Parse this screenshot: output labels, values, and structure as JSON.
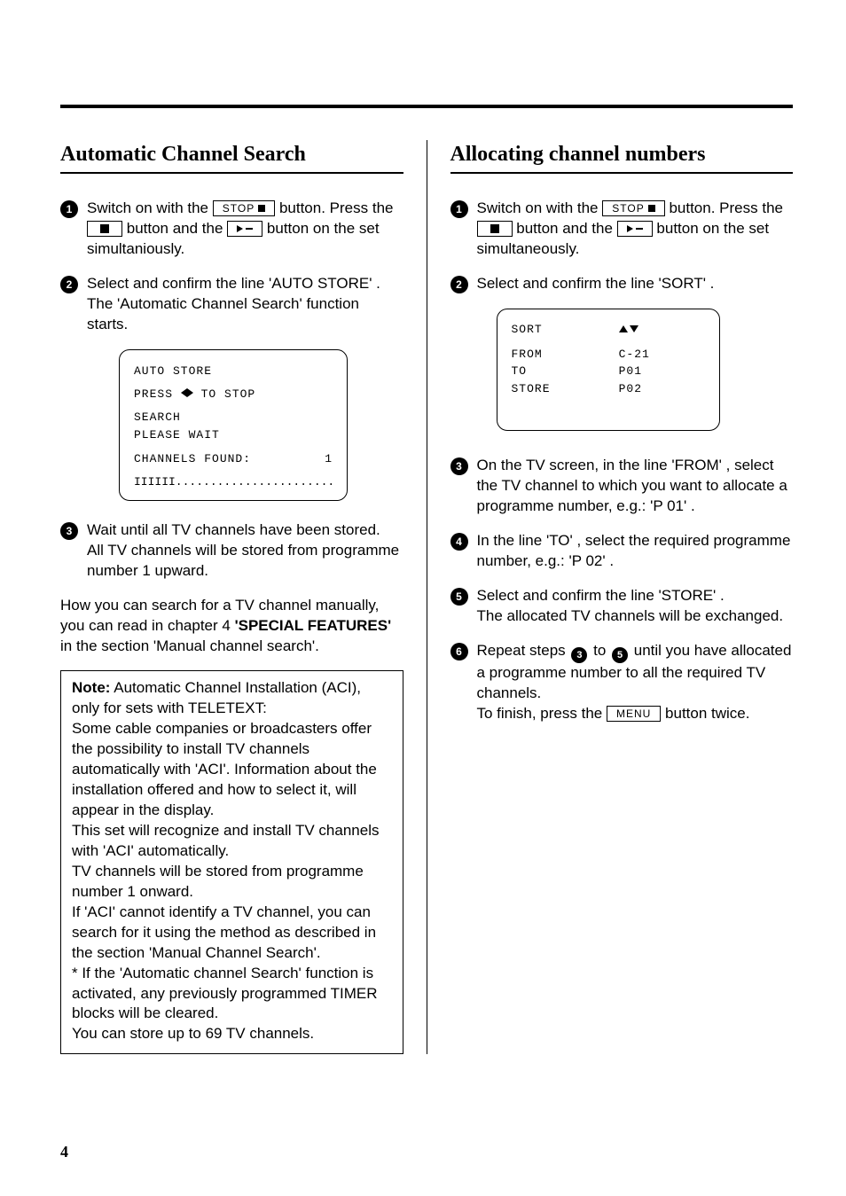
{
  "page_number": "4",
  "buttons": {
    "stop": "STOP",
    "menu": "MENU"
  },
  "left": {
    "title": "Automatic Channel Search",
    "step1_a": "Switch on with the ",
    "step1_b": " button. Press the ",
    "step1_c": " button and the ",
    "step1_d": " button on the set simultaniously.",
    "step2_a": "Select and confirm the line 'AUTO STORE' .",
    "step2_b": "The 'Automatic Channel Search' function starts.",
    "osd": {
      "l1": "AUTO STORE",
      "l2a": "PRESS ",
      "l2b": " TO STOP",
      "l3": "SEARCH",
      "l4": "PLEASE WAIT",
      "l5_label": "CHANNELS FOUND:",
      "l5_value": "1",
      "prog": "IIIIII.................................."
    },
    "step3_a": "Wait until all TV channels have been stored.",
    "step3_b": "All TV channels will be stored from programme number 1 upward.",
    "manual_a": "How you can search for a TV channel manually, you can read in chapter 4 ",
    "manual_b": "'SPECIAL FEATURES'",
    "manual_c": " in the section 'Manual channel search'.",
    "note": {
      "lead": "Note:",
      "l1": " Automatic Channel Installation (ACI), only for sets with TELETEXT:",
      "l2": "Some cable companies or broadcasters offer the possibility to install TV channels automatically with 'ACI'. Information about the installation offered and how to select it, will appear in the display.",
      "l3": "This set will recognize and install TV channels with 'ACI' automatically.",
      "l4": "TV channels will be stored from programme number 1 onward.",
      "l5": "If 'ACI' cannot identify a TV channel, you can search for it using the method as described in the section 'Manual Channel Search'.",
      "l6": "* If the 'Automatic channel Search' function is activated, any previously programmed TIMER blocks will be cleared.",
      "l7": "You can store up to 69 TV channels."
    }
  },
  "right": {
    "title": "Allocating channel numbers",
    "step1_a": "Switch on with the ",
    "step1_b": " button. Press the ",
    "step1_c": " button and the ",
    "step1_d": " button on the set simultaneously.",
    "step2": "Select and confirm the line 'SORT' .",
    "osd": {
      "r1_label": "SORT",
      "r2_label": "FROM",
      "r2_val": "C-21",
      "r3_label": "TO",
      "r3_val": "P01",
      "r4_label": "STORE",
      "r4_val": "P02"
    },
    "step3": "On the TV screen, in the line 'FROM' , select the TV channel to which you want to allocate a programme number, e.g.: 'P 01' .",
    "step4": "In the line 'TO' , select the required programme number, e.g.: 'P 02' .",
    "step5_a": "Select and confirm the line 'STORE' .",
    "step5_b": "The allocated TV channels will be exchanged.",
    "step6_a": "Repeat steps ",
    "step6_b": " to ",
    "step6_c": " until you have allocated a programme number to all the required TV channels.",
    "step6_d": "To finish, press the ",
    "step6_e": " button twice."
  }
}
